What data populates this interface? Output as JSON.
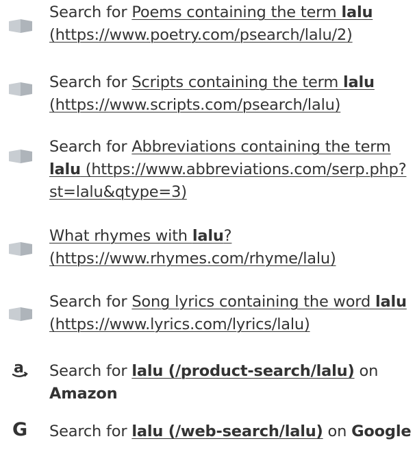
{
  "items": [
    {
      "type": "book",
      "prefix": "Search for ",
      "link_text": "Poems containing the term ",
      "term": "lalu",
      "url": " (https://www.poetry.com/psearch/lalu/2)",
      "suffix": ""
    },
    {
      "type": "book",
      "prefix": "Search for ",
      "link_text": "Scripts containing the term ",
      "term": "lalu",
      "url": " (https://www.scripts.com/psearch/lalu)",
      "suffix": ""
    },
    {
      "type": "book",
      "prefix": "Search for ",
      "link_text": "Abbreviations containing the term ",
      "term": "lalu",
      "url": " (https://www.abbreviations.com/serp.php?st=lalu&qtype=3)",
      "suffix": ""
    },
    {
      "type": "book",
      "prefix": "",
      "link_text": "What rhymes with ",
      "term": "lalu",
      "link_tail": "?",
      "url": " (https://www.rhymes.com/rhyme/lalu)",
      "suffix": ""
    },
    {
      "type": "book",
      "prefix": "Search for ",
      "link_text": "Song lyrics containing the word ",
      "term": "lalu",
      "url": " (https://www.lyrics.com/lyrics/lalu)",
      "suffix": ""
    },
    {
      "type": "amazon",
      "prefix": "Search for ",
      "bold_link": "lalu (/product-search/lalu)",
      "suffix_pre": " on ",
      "brand": "Amazon"
    },
    {
      "type": "google",
      "prefix": "Search for ",
      "bold_link": "lalu (/web-search/lalu)",
      "suffix_pre": " on ",
      "brand": "Google"
    }
  ],
  "colors": {
    "text": "#333333",
    "book_icon_dark": "#aeb4ba",
    "book_icon_light": "#c8cdd2",
    "brand_icon": "#333333"
  },
  "icons": [
    "book-icon",
    "book-icon",
    "book-icon",
    "book-icon",
    "book-icon",
    "amazon-icon",
    "google-icon"
  ]
}
